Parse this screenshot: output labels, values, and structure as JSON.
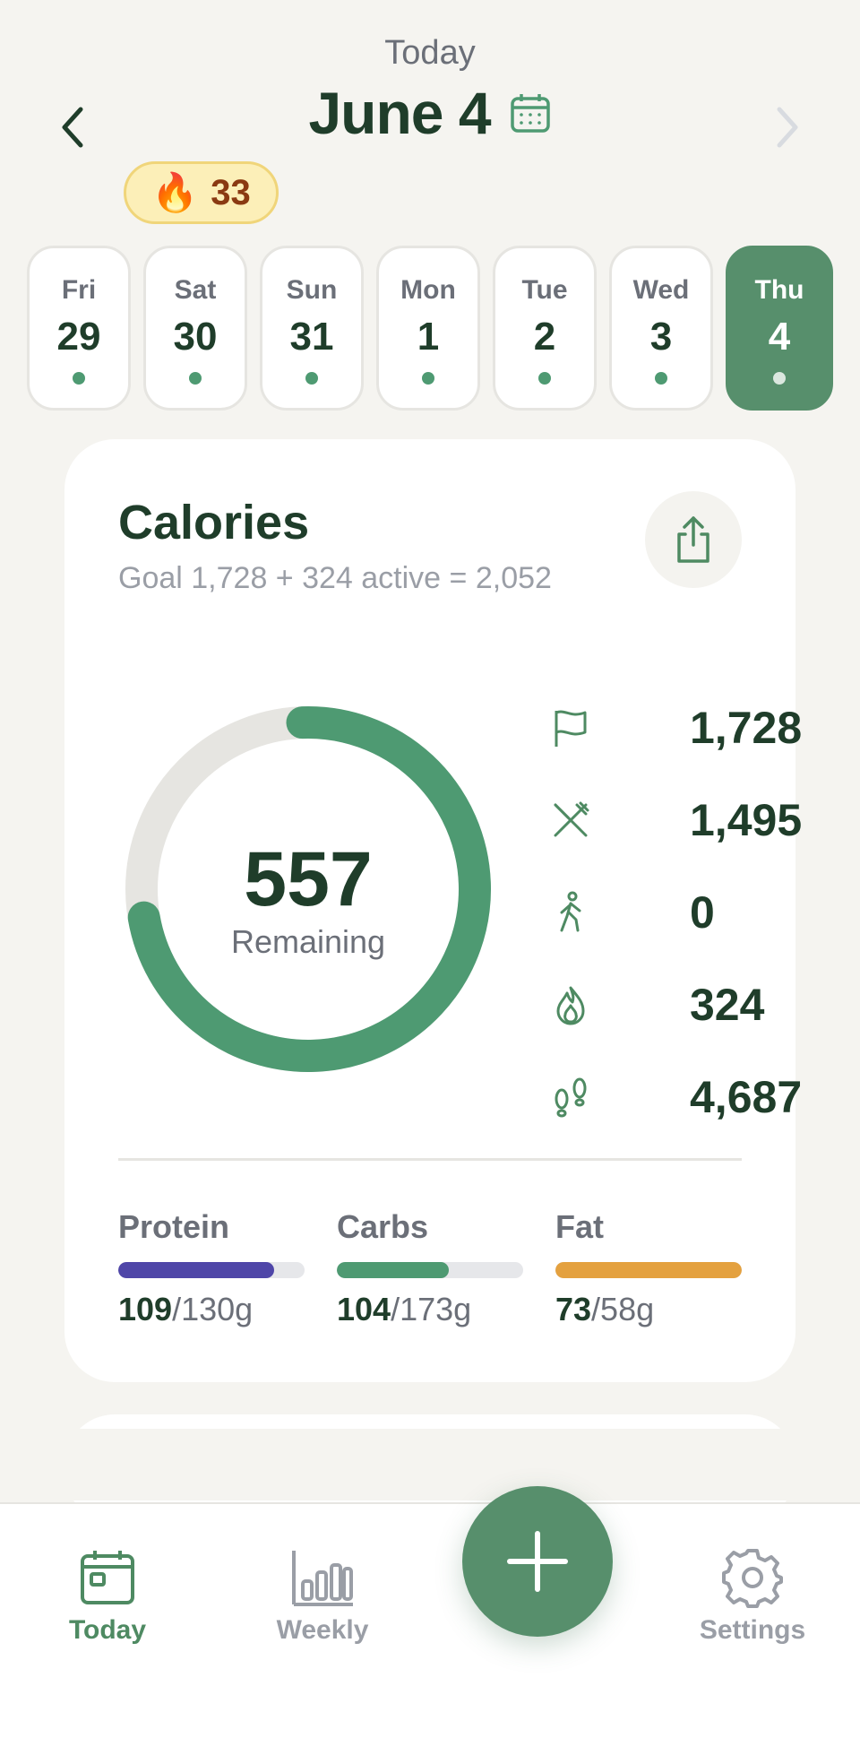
{
  "header": {
    "today_label": "Today",
    "date_title": "June 4",
    "streak_icon": "🔥",
    "streak_count": "33"
  },
  "days": [
    {
      "name": "Fri",
      "num": "29",
      "active": false
    },
    {
      "name": "Sat",
      "num": "30",
      "active": false
    },
    {
      "name": "Sun",
      "num": "31",
      "active": false
    },
    {
      "name": "Mon",
      "num": "1",
      "active": false
    },
    {
      "name": "Tue",
      "num": "2",
      "active": false
    },
    {
      "name": "Wed",
      "num": "3",
      "active": false
    },
    {
      "name": "Thu",
      "num": "4",
      "active": true
    }
  ],
  "calories": {
    "title": "Calories",
    "subtitle": "Goal 1,728 + 324 active = 2,052",
    "remaining_value": "557",
    "remaining_label": "Remaining",
    "progress_fraction": 0.728,
    "stats": [
      {
        "icon": "flag-icon",
        "value": "1,728"
      },
      {
        "icon": "fork-knife-icon",
        "value": "1,495"
      },
      {
        "icon": "walking-icon",
        "value": "0"
      },
      {
        "icon": "flame-icon",
        "value": "324"
      },
      {
        "icon": "footprints-icon",
        "value": "4,687"
      }
    ]
  },
  "macros": [
    {
      "name": "Protein",
      "eaten": "109",
      "rest": "/130g",
      "fill": 0.838,
      "color": "#4f46a8"
    },
    {
      "name": "Carbs",
      "eaten": "104",
      "rest": "/173g",
      "fill": 0.601,
      "color": "#4e9a72"
    },
    {
      "name": "Fat",
      "eaten": "73",
      "rest": "/58g",
      "fill": 1.0,
      "color": "#e4a13f"
    }
  ],
  "tabs": {
    "today": "Today",
    "weekly": "Weekly",
    "settings": "Settings"
  },
  "colors": {
    "accent": "#578f6c",
    "ring": "#4e9a72",
    "ring_track": "#e6e5e1"
  }
}
